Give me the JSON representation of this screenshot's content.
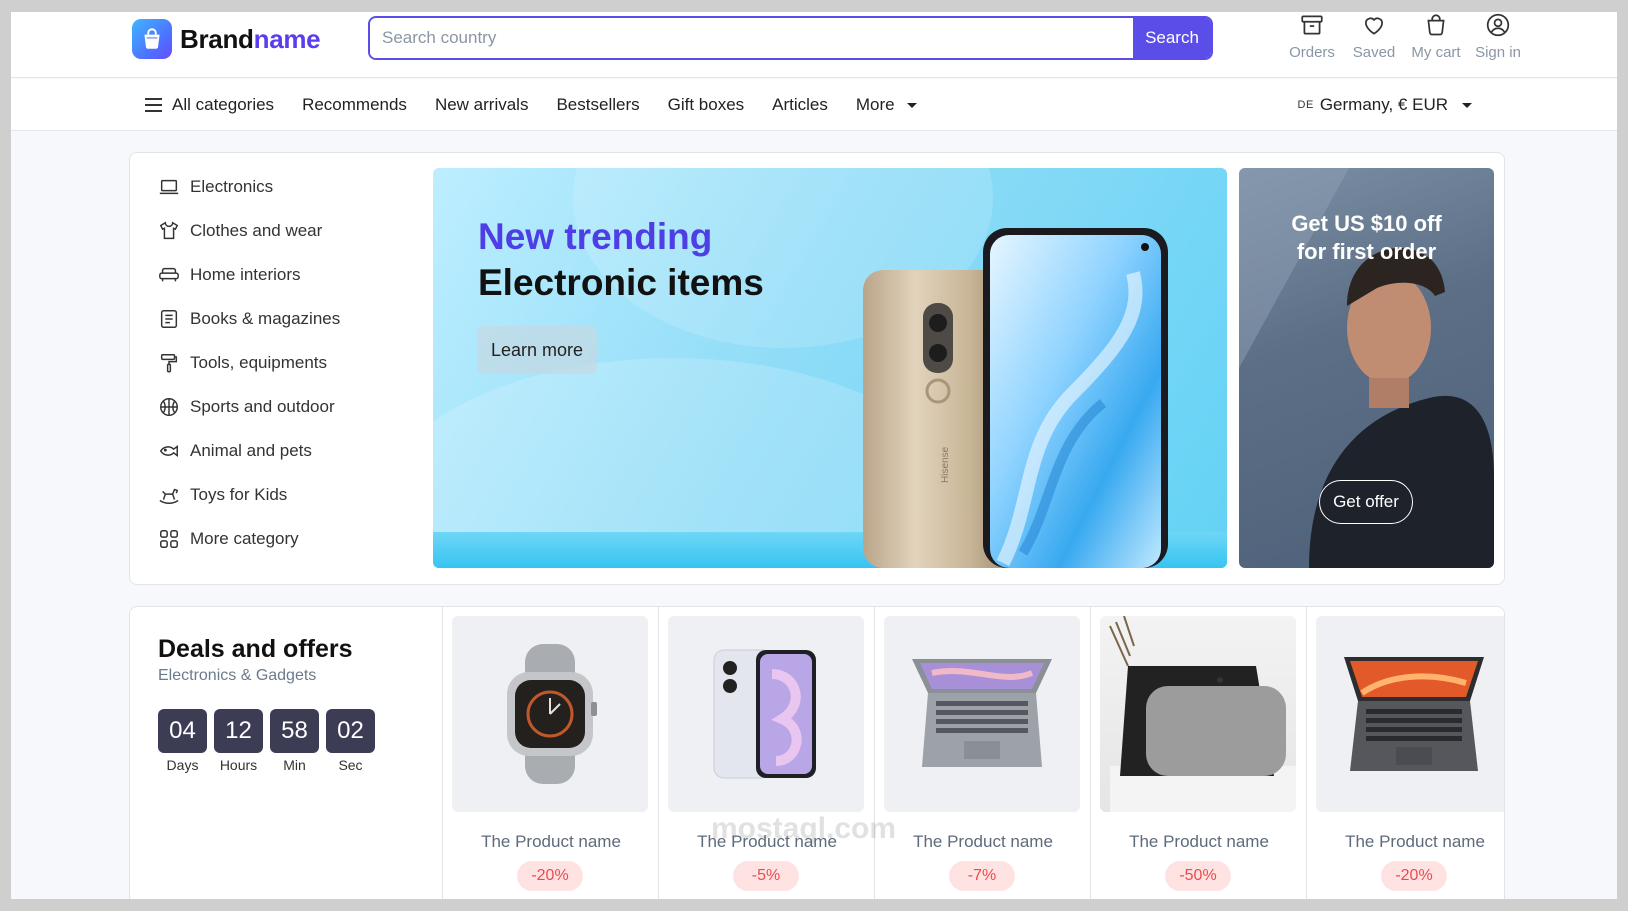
{
  "brand": {
    "part1": "Brand",
    "part2": "name"
  },
  "search": {
    "placeholder": "Search country",
    "button": "Search"
  },
  "actions": [
    {
      "icon": "archive-icon",
      "label": "Orders"
    },
    {
      "icon": "heart-icon",
      "label": "Saved"
    },
    {
      "icon": "cart-icon",
      "label": "My cart"
    },
    {
      "icon": "user-icon",
      "label": "Sign in"
    }
  ],
  "nav": {
    "all_categories": "All categories",
    "items": [
      "Recommends",
      "New arrivals",
      "Bestsellers",
      "Gift boxes",
      "Articles"
    ],
    "more": "More",
    "region_flag": "DE",
    "region": "Germany, € EUR"
  },
  "categories": [
    {
      "icon": "laptop-icon",
      "label": "Electronics"
    },
    {
      "icon": "tshirt-icon",
      "label": "Clothes and wear"
    },
    {
      "icon": "sofa-icon",
      "label": "Home interiors"
    },
    {
      "icon": "book-icon",
      "label": "Books & magazines"
    },
    {
      "icon": "paint-roller-icon",
      "label": "Tools, equipments"
    },
    {
      "icon": "basketball-icon",
      "label": "Sports and outdoor"
    },
    {
      "icon": "fish-icon",
      "label": "Animal and pets"
    },
    {
      "icon": "rocking-horse-icon",
      "label": "Toys for Kids"
    },
    {
      "icon": "grid-icon",
      "label": "More category"
    }
  ],
  "banner": {
    "title_line1": "New trending",
    "title_line2": "Electronic items",
    "cta": "Learn more",
    "phone_brand": "Hisense"
  },
  "promo": {
    "line1": "Get US $10 off",
    "line2": "for first order",
    "cta": "Get offer"
  },
  "deals": {
    "title": "Deals and offers",
    "subtitle": "Electronics & Gadgets",
    "timer": [
      {
        "value": "04",
        "label": "Days"
      },
      {
        "value": "12",
        "label": "Hours"
      },
      {
        "value": "58",
        "label": "Min"
      },
      {
        "value": "02",
        "label": "Sec"
      }
    ],
    "products": [
      {
        "image": "smartwatch",
        "name": "The Product name",
        "discount": "-20%"
      },
      {
        "image": "smartphone",
        "name": "The Product name",
        "discount": "-5%"
      },
      {
        "image": "laptop-gray",
        "name": "The Product name",
        "discount": "-7%"
      },
      {
        "image": "smart-display",
        "name": "The Product name",
        "discount": "-50%"
      },
      {
        "image": "laptop-orange",
        "name": "The Product name",
        "discount": "-20%"
      }
    ]
  },
  "watermark": "mostaql.com"
}
